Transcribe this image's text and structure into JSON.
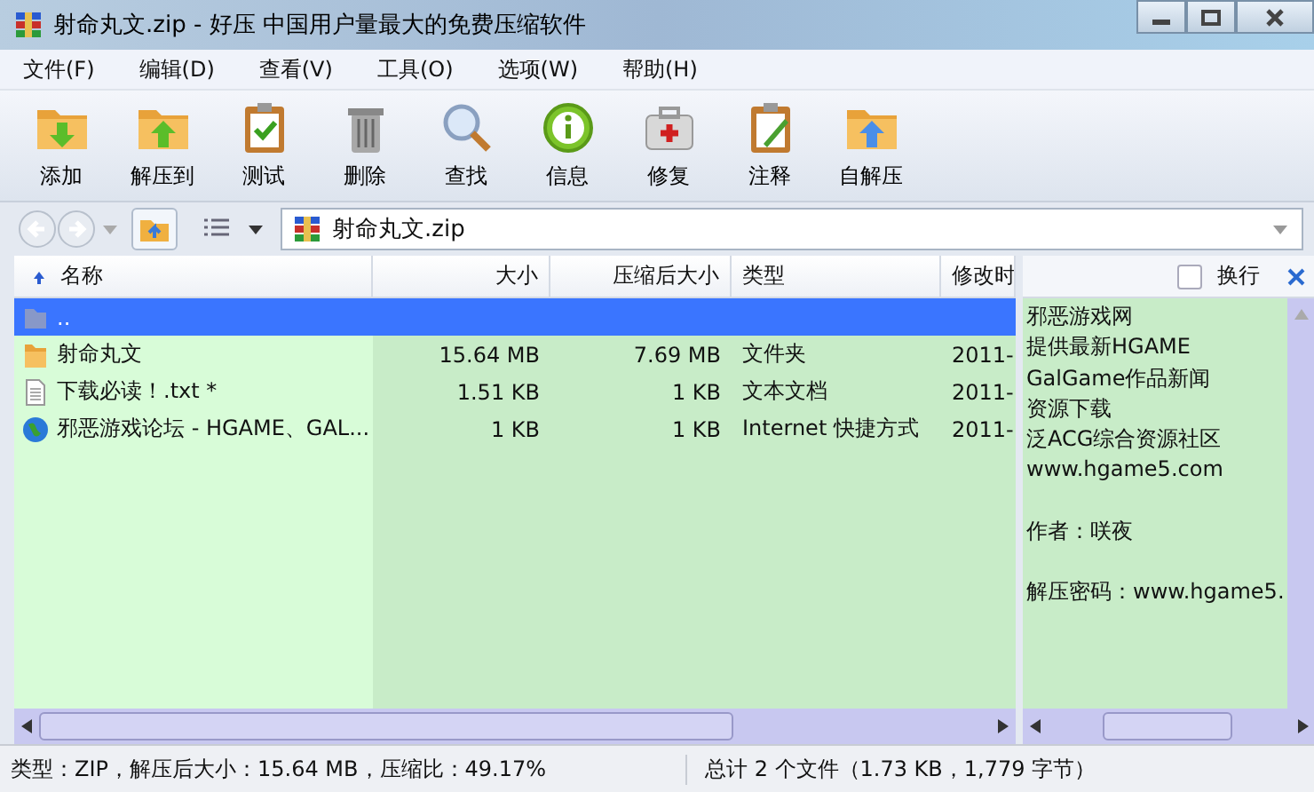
{
  "window": {
    "title": "射命丸文.zip - 好压 中国用户量最大的免费压缩软件"
  },
  "menu": [
    "文件(F)",
    "编辑(D)",
    "查看(V)",
    "工具(O)",
    "选项(W)",
    "帮助(H)"
  ],
  "toolbar": [
    {
      "kind": "add",
      "label": "添加"
    },
    {
      "kind": "extract",
      "label": "解压到"
    },
    {
      "kind": "test",
      "label": "测试"
    },
    {
      "kind": "delete",
      "label": "删除"
    },
    {
      "kind": "find",
      "label": "查找"
    },
    {
      "kind": "info",
      "label": "信息"
    },
    {
      "kind": "repair",
      "label": "修复"
    },
    {
      "kind": "comment",
      "label": "注释"
    },
    {
      "kind": "sfx",
      "label": "自解压"
    }
  ],
  "address": {
    "path": "射命丸文.zip"
  },
  "table": {
    "columns": [
      "名称",
      "大小",
      "压缩后大小",
      "类型",
      "修改时"
    ],
    "rows": [
      {
        "kind": "up",
        "name": "..",
        "size": "",
        "packed": "",
        "type": "",
        "modified": "",
        "selected": true
      },
      {
        "kind": "folder",
        "name": "射命丸文",
        "size": "15.64 MB",
        "packed": "7.69 MB",
        "type": "文件夹",
        "modified": "2011-",
        "selected": false
      },
      {
        "kind": "text",
        "name": "下载必读！.txt *",
        "size": "1.51 KB",
        "packed": "1 KB",
        "type": "文本文档",
        "modified": "2011-",
        "selected": false
      },
      {
        "kind": "link",
        "name": "邪恶游戏论坛 - HGAME、GAL...",
        "size": "1 KB",
        "packed": "1 KB",
        "type": "Internet 快捷方式",
        "modified": "2011-",
        "selected": false
      }
    ]
  },
  "comment_pane": {
    "wrap_label": "换行",
    "wrap_checked": false,
    "paragraphs": [
      [
        "邪恶游戏网",
        "提供最新HGAME",
        "GalGame作品新闻",
        "资源下载",
        "泛ACG综合资源社区",
        "www.hgame5.com"
      ],
      [
        "作者：咲夜"
      ],
      [
        "解压密码：www.hgame5."
      ]
    ]
  },
  "status_bar": {
    "left": "类型：ZIP，解压后大小：15.64 MB，压缩比：49.17%",
    "right": "总计 2 个文件（1.73 KB，1,779 字节）"
  }
}
